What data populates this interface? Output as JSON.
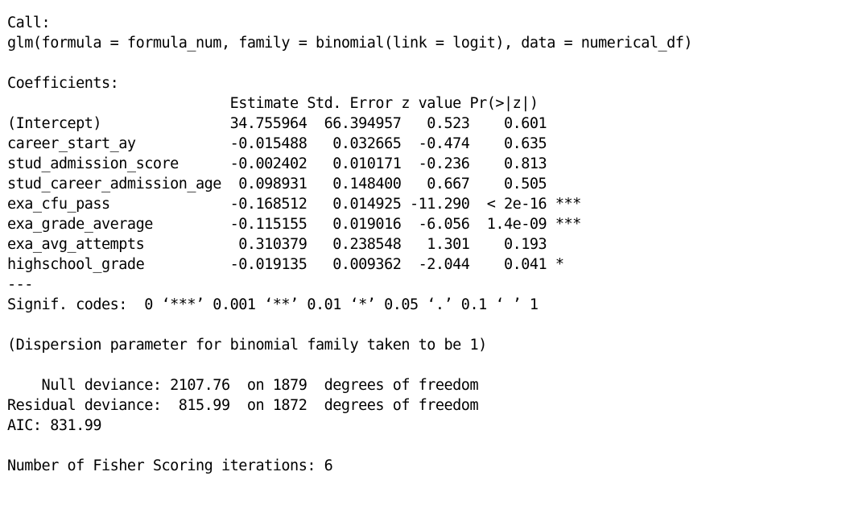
{
  "output": {
    "call_label": "Call:",
    "call_text": "glm(formula = formula_num, family = binomial(link = logit), data = numerical_df)",
    "coefficients_label": "Coefficients:",
    "table_header": "                          Estimate Std. Error z value Pr(>|z|)    ",
    "rows": [
      "(Intercept)               34.755964  66.394957   0.523    0.601    ",
      "career_start_ay           -0.015488   0.032665  -0.474    0.635    ",
      "stud_admission_score      -0.002402   0.010171  -0.236    0.813    ",
      "stud_career_admission_age  0.098931   0.148400   0.667    0.505    ",
      "exa_cfu_pass              -0.168512   0.014925 -11.290  < 2e-16 ***",
      "exa_grade_average         -0.115155   0.019016  -6.056  1.4e-09 ***",
      "exa_avg_attempts           0.310379   0.238548   1.301    0.193    ",
      "highschool_grade          -0.019135   0.009362  -2.044    0.041 *  "
    ],
    "separator": "---",
    "signif_codes": "Signif. codes:  0 ‘***’ 0.001 ‘**’ 0.01 ‘*’ 0.05 ‘.’ 0.1 ‘ ’ 1",
    "dispersion": "(Dispersion parameter for binomial family taken to be 1)",
    "null_deviance": "    Null deviance: 2107.76  on 1879  degrees of freedom",
    "residual_deviance": "Residual deviance:  815.99  on 1872  degrees of freedom",
    "aic": "AIC: 831.99",
    "fisher_iterations": "Number of Fisher Scoring iterations: 6"
  }
}
